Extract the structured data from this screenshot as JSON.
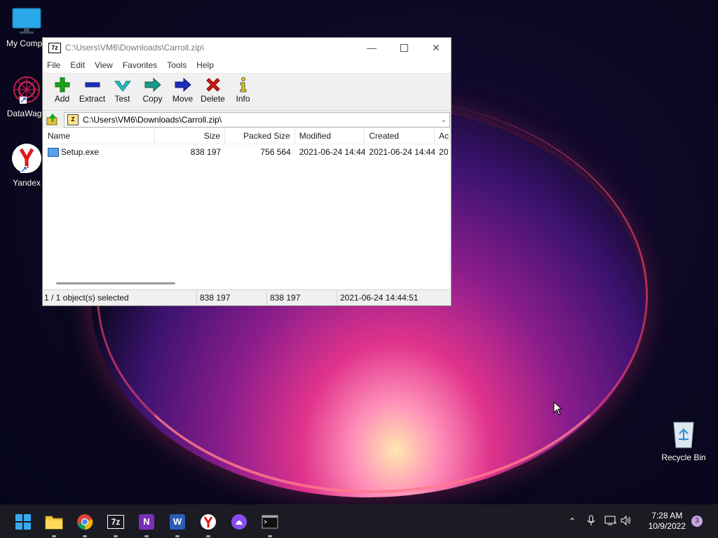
{
  "desktop": {
    "icons": [
      {
        "label": "My Compu"
      },
      {
        "label": "DataWago"
      },
      {
        "label": "Yandex"
      },
      {
        "label": "Recycle Bin"
      }
    ]
  },
  "window": {
    "title": "C:\\Users\\VM6\\Downloads\\Carroll.zip\\",
    "app_icon_text": "7z",
    "menu": [
      "File",
      "Edit",
      "View",
      "Favorites",
      "Tools",
      "Help"
    ],
    "toolbar": [
      {
        "label": "Add",
        "icon": "plus-icon",
        "color": "#1aa31a"
      },
      {
        "label": "Extract",
        "icon": "minus-icon",
        "color": "#1b2fb8"
      },
      {
        "label": "Test",
        "icon": "check-icon",
        "color": "#20b8b8"
      },
      {
        "label": "Copy",
        "icon": "copy-arrow-icon",
        "color": "#1a8a7a"
      },
      {
        "label": "Move",
        "icon": "move-arrow-icon",
        "color": "#1b2fb8"
      },
      {
        "label": "Delete",
        "icon": "delete-x-icon",
        "color": "#d01818"
      },
      {
        "label": "Info",
        "icon": "info-icon",
        "color": "#d4c400"
      }
    ],
    "address": "C:\\Users\\VM6\\Downloads\\Carroll.zip\\",
    "columns": [
      "Name",
      "Size",
      "Packed Size",
      "Modified",
      "Created",
      "Ac"
    ],
    "rows": [
      {
        "name": "Setup.exe",
        "size": "838 197",
        "packed": "756 564",
        "modified": "2021-06-24 14:44",
        "created": "2021-06-24 14:44",
        "accessed": "20"
      }
    ],
    "status": {
      "selected": "1 / 1 object(s) selected",
      "size": "838 197",
      "packed": "838 197",
      "date": "2021-06-24 14:44:51"
    }
  },
  "taskbar": {
    "apps": [
      "start-icon",
      "file-explorer-icon",
      "chrome-icon",
      "7zip-icon",
      "onenote-icon",
      "word-icon",
      "yandex-browser-icon",
      "alice-icon",
      "terminal-icon"
    ],
    "app_texts": {
      "sevenzip": "7z",
      "onenote": "N",
      "word": "W"
    },
    "time": "7:28 AM",
    "date": "10/9/2022",
    "notifications": "3"
  }
}
